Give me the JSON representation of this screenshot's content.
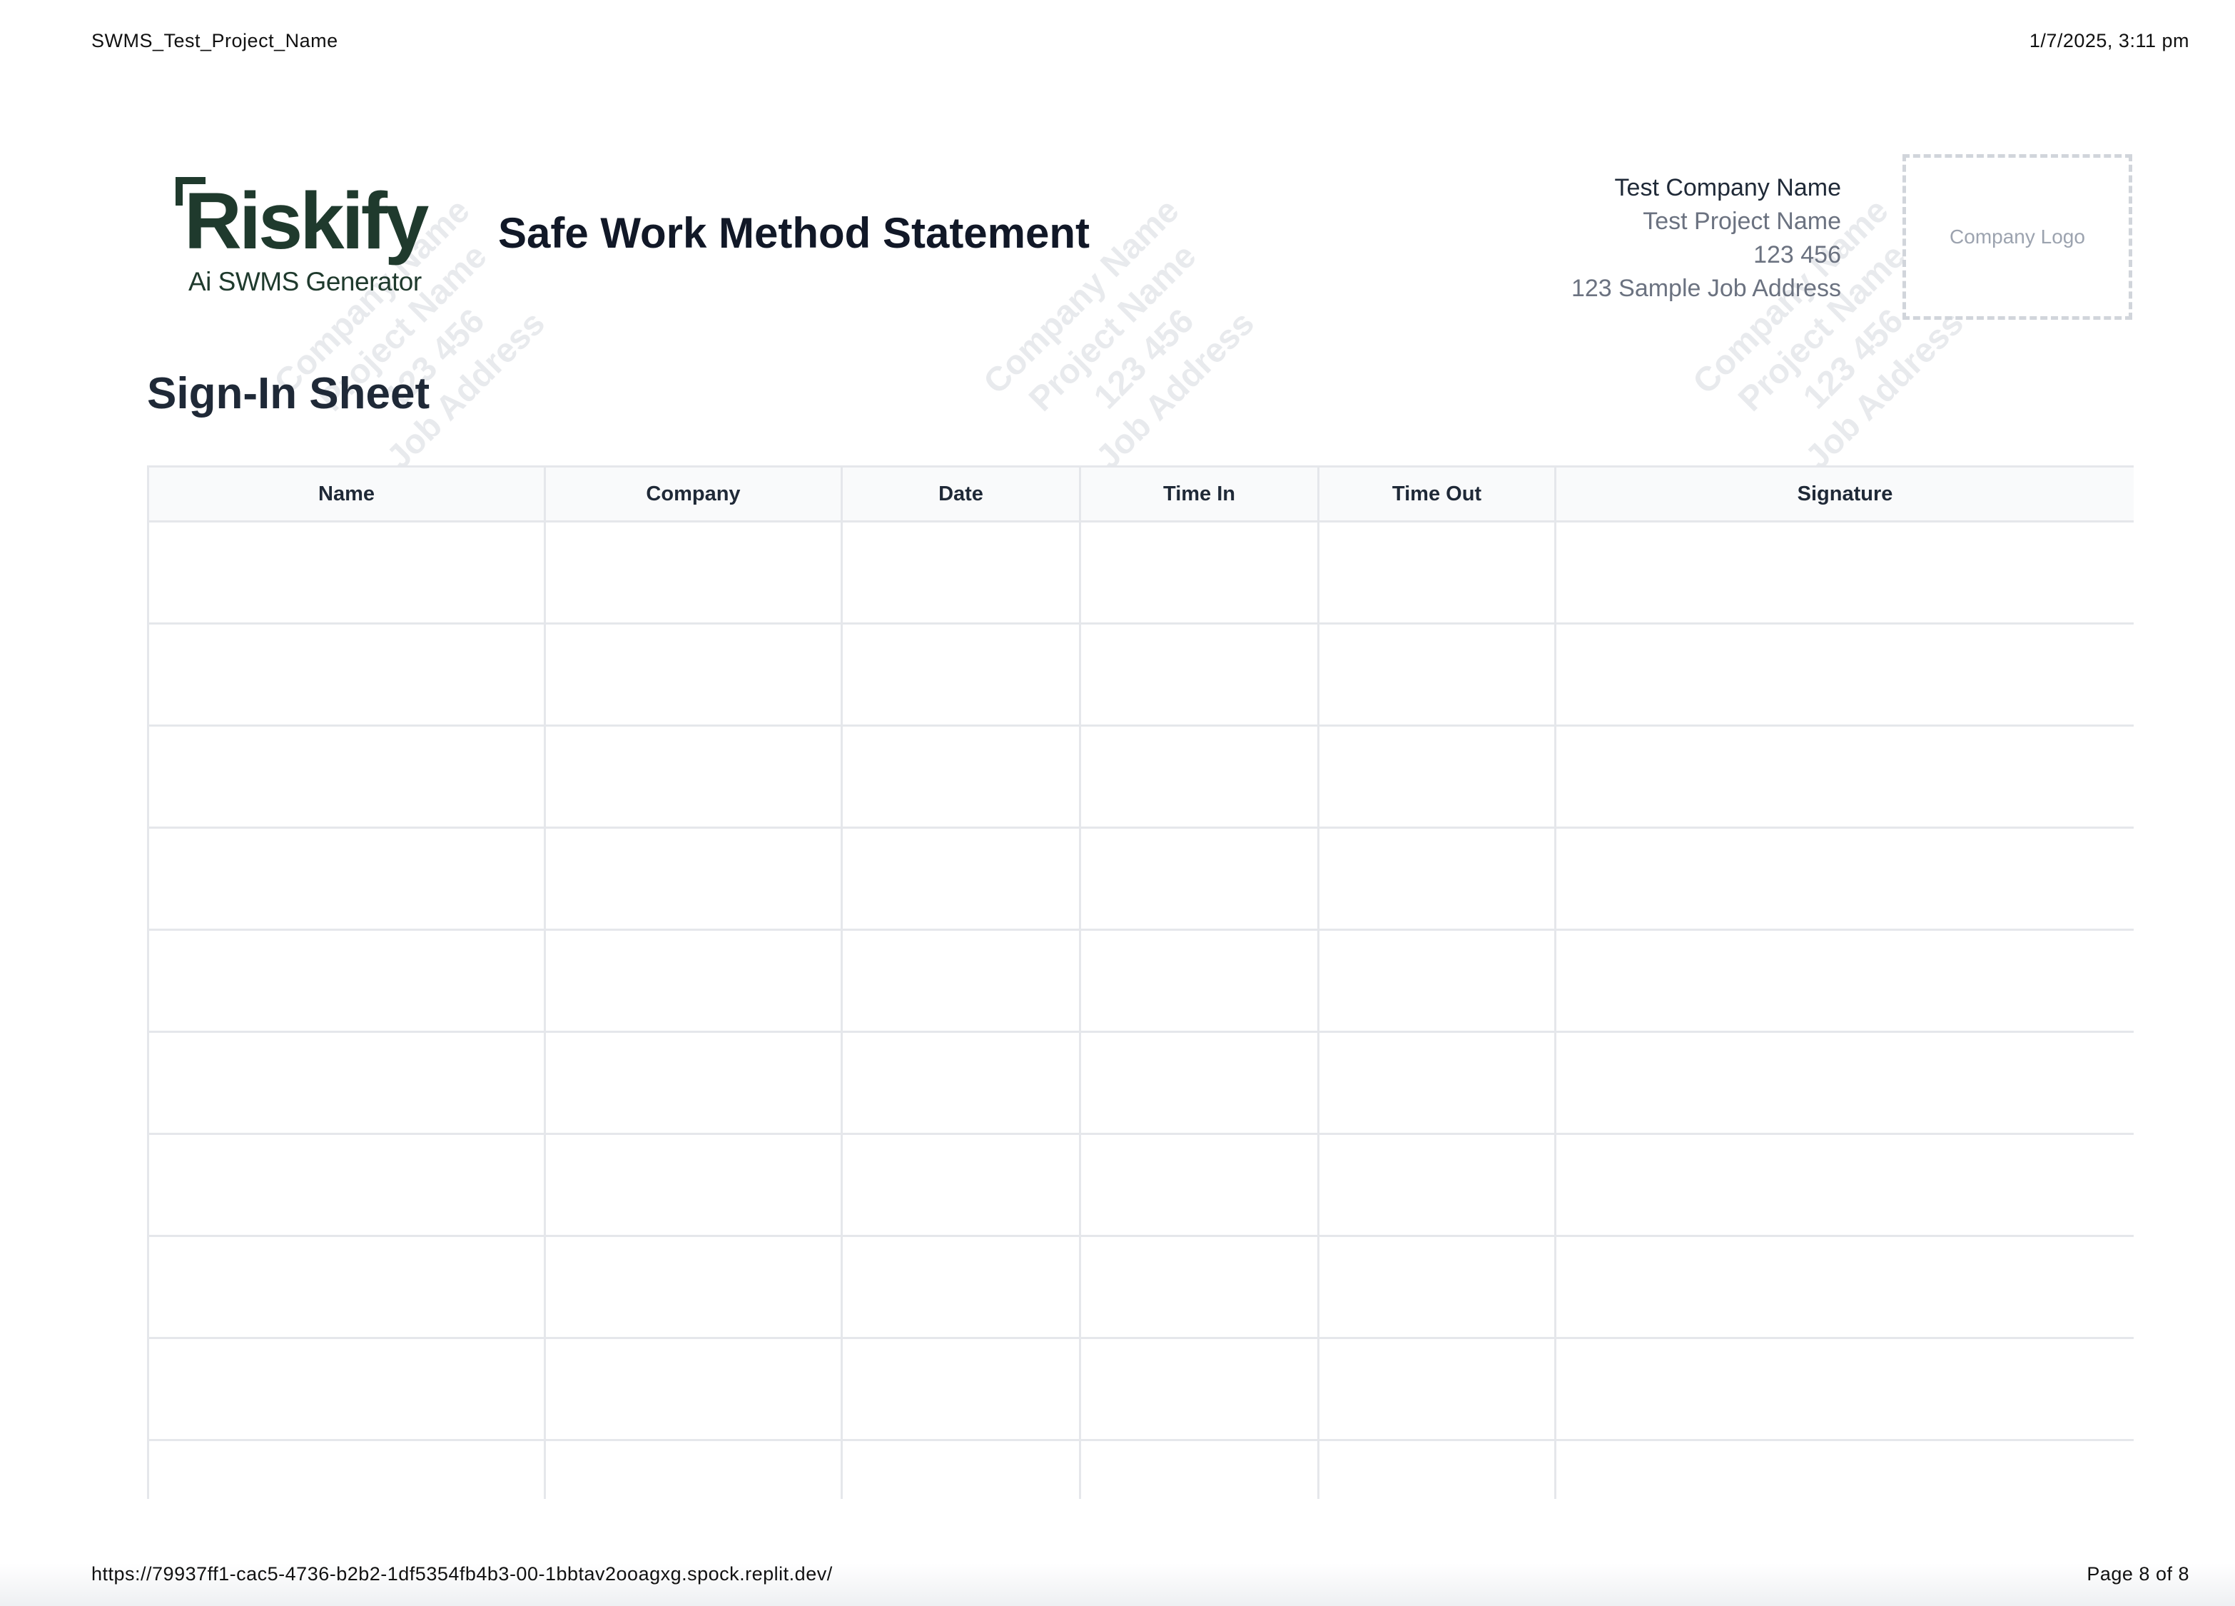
{
  "print_header": {
    "doc_name": "SWMS_Test_Project_Name",
    "datetime": "1/7/2025, 3:11 pm"
  },
  "print_footer": {
    "url": "https://79937ff1-cac5-4736-b2b2-1df5354fb4b3-00-1bbtav2ooagxg.spock.replit.dev/",
    "page": "Page 8 of 8"
  },
  "logo": {
    "wordmark": "Riskify",
    "tagline": "Ai SWMS Generator",
    "color": "#1f3a2d"
  },
  "header": {
    "title": "Safe Work Method Statement",
    "company_name": "Test Company Name",
    "project_name": "Test Project Name",
    "project_number": "123 456",
    "job_address": "123 Sample Job Address",
    "logo_placeholder": "Company Logo"
  },
  "watermark": {
    "lines": [
      "Company Name",
      "Project Name",
      "123 456",
      "Job Address"
    ]
  },
  "section": {
    "title": "Sign-In Sheet"
  },
  "table": {
    "columns": [
      "Name",
      "Company",
      "Date",
      "Time In",
      "Time Out",
      "Signature"
    ],
    "rows": [
      [
        "",
        "",
        "",
        "",
        "",
        ""
      ],
      [
        "",
        "",
        "",
        "",
        "",
        ""
      ],
      [
        "",
        "",
        "",
        "",
        "",
        ""
      ],
      [
        "",
        "",
        "",
        "",
        "",
        ""
      ],
      [
        "",
        "",
        "",
        "",
        "",
        ""
      ],
      [
        "",
        "",
        "",
        "",
        "",
        ""
      ],
      [
        "",
        "",
        "",
        "",
        "",
        ""
      ],
      [
        "",
        "",
        "",
        "",
        "",
        ""
      ],
      [
        "",
        "",
        "",
        "",
        "",
        ""
      ],
      [
        "",
        "",
        "",
        "",
        "",
        ""
      ]
    ]
  }
}
